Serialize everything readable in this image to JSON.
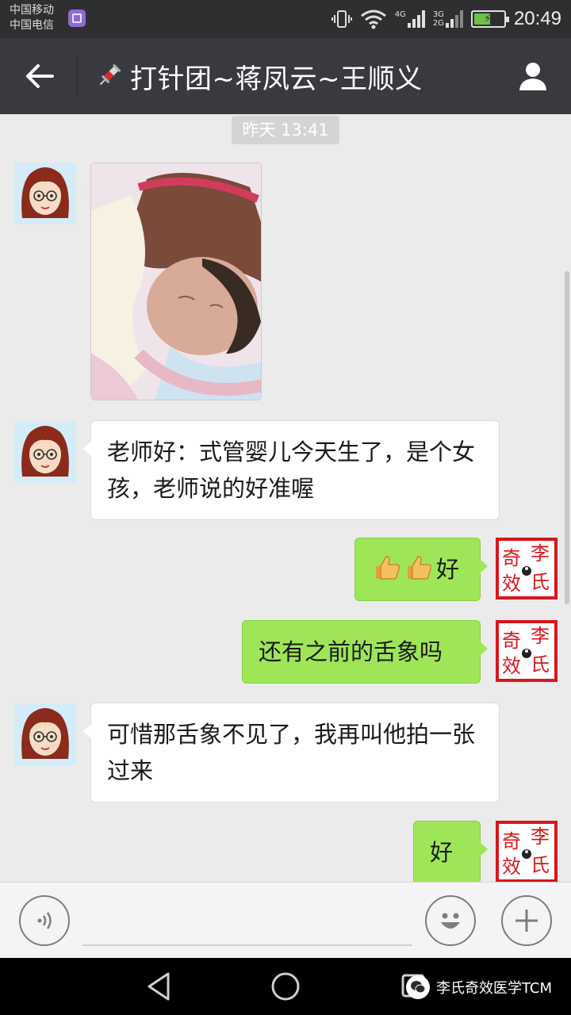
{
  "status_bar": {
    "carrier_1": "中国移动",
    "carrier_2": "中国电信",
    "network_4g": "4G",
    "network_3g": "3G",
    "network_2g": "2G",
    "time": "20:49",
    "battery_level": 0.55,
    "icons": [
      "vibrate-icon",
      "wifi-icon",
      "signal-icon",
      "battery-icon"
    ]
  },
  "title_bar": {
    "title": "打针团~蒋凤云~王顺义",
    "title_emoji": "syringe-icon",
    "back_icon": "arrow-left-icon",
    "profile_icon": "person-icon"
  },
  "chat": {
    "timestamp": "昨天 13:41",
    "messages": [
      {
        "side": "in",
        "type": "image",
        "description_icon": "newborn-photo"
      },
      {
        "side": "in",
        "type": "text",
        "text": "老师好：式管婴儿今天生了，是个女孩，老师说的好准喔"
      },
      {
        "side": "out",
        "type": "text",
        "text": "好",
        "emoji": [
          "thumbs-up-icon",
          "thumbs-up-icon"
        ]
      },
      {
        "side": "out",
        "type": "text",
        "text": "还有之前的舌象吗"
      },
      {
        "side": "in",
        "type": "text",
        "text": "可惜那舌象不见了，我再叫他拍一张过来"
      },
      {
        "side": "out",
        "type": "text",
        "text": "好"
      }
    ],
    "seal_chars": [
      "奇",
      "李",
      "效",
      "氏"
    ]
  },
  "input_bar": {
    "voice_icon": "voice-icon",
    "emoji_icon": "smiley-icon",
    "more_icon": "plus-icon"
  },
  "nav_bar": {
    "back_icon": "triangle-back-icon",
    "home_icon": "circle-home-icon",
    "watermark_text": "李氏奇效医学TCM"
  },
  "colors": {
    "status_bar": "#2f2f31",
    "title_bar": "#393a3f",
    "chat_bg": "#ebebeb",
    "bubble_out": "#9ee658",
    "bubble_in": "#ffffff",
    "seal_red": "#d8161b"
  }
}
